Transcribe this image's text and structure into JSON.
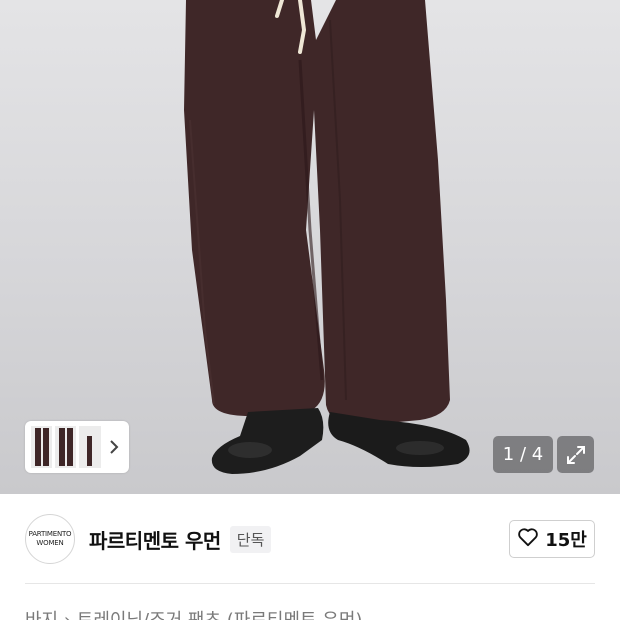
{
  "gallery": {
    "counter": "1 / 4",
    "thumbnail_count": 3
  },
  "brand": {
    "logo_line1": "PARTIMENTO",
    "logo_line2": "WOMEN",
    "name": "파르티멘토 우먼",
    "badge": "단독",
    "likes": "15만"
  },
  "breadcrumb": "바지 › 트레이닝/조거 팬츠 (파르티멘토 우먼)",
  "colors": {
    "pants": "#3e2627",
    "shoes": "#1c1c1c",
    "overlay": "#5f5f62"
  }
}
